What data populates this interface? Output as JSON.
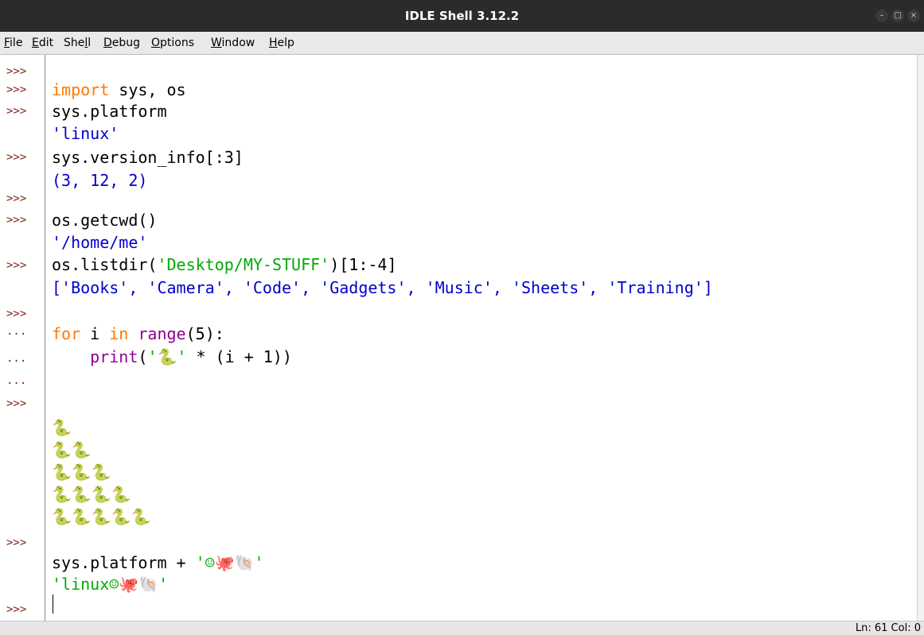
{
  "window": {
    "title": "IDLE Shell 3.12.2",
    "controls": [
      "minimize",
      "maximize",
      "close"
    ]
  },
  "menubar": {
    "items": [
      {
        "label_u": "F",
        "label_rest": "ile"
      },
      {
        "label_u": "E",
        "label_rest": "dit"
      },
      {
        "label_pre": "She",
        "label_u": "l",
        "label_rest": "l"
      },
      {
        "label_u": "D",
        "label_rest": "ebug"
      },
      {
        "label_u": "O",
        "label_rest": "ptions"
      },
      {
        "label_u": "W",
        "label_rest": "indow"
      },
      {
        "label_u": "H",
        "label_rest": "elp"
      }
    ]
  },
  "shell": {
    "prompts": [
      ">>>",
      ">>>",
      ">>>",
      ">>>",
      ">>>",
      ">>>",
      ">>>",
      ">>>",
      "...",
      "...",
      "...",
      ">>>",
      ">>>",
      ">>>"
    ],
    "lines": {
      "l1_kw": "import",
      "l1_rest": " sys, os",
      "l2": "sys.platform",
      "l3_out": "'linux'",
      "l4": "sys.version_info[:3]",
      "l5_out": "(3, 12, 2)",
      "l6": "os.getcwd()",
      "l7_out": "'/home/me'",
      "l8_a": "os.listdir(",
      "l8_str": "'Desktop/MY-STUFF'",
      "l8_b": ")[1:-4]",
      "l9_out": "['Books', 'Camera', 'Code', 'Gadgets', 'Music', 'Sheets', 'Training']",
      "l10_kw1": "for",
      "l10_a": " i ",
      "l10_kw2": "in",
      "l10_sp": " ",
      "l10_bi": "range",
      "l10_b": "(5):",
      "l11_indent": "    ",
      "l11_bi": "print",
      "l11_a": "(",
      "l11_str": "'🐍'",
      "l11_b": " * (i + 1))",
      "snakes": [
        "🐍",
        "🐍🐍",
        "🐍🐍🐍",
        "🐍🐍🐍🐍",
        "🐍🐍🐍🐍🐍"
      ],
      "l12_a": "sys.platform + ",
      "l12_str": "'☺🐙🐚'",
      "l13_out": "'linux☺🐙🐚'"
    }
  },
  "statusbar": {
    "position": "Ln: 61 Col: 0"
  },
  "colors": {
    "keyword": "#ff7700",
    "builtin": "#900090",
    "string": "#00aa00",
    "output": "#0000cc",
    "prompt": "#7a2416"
  }
}
